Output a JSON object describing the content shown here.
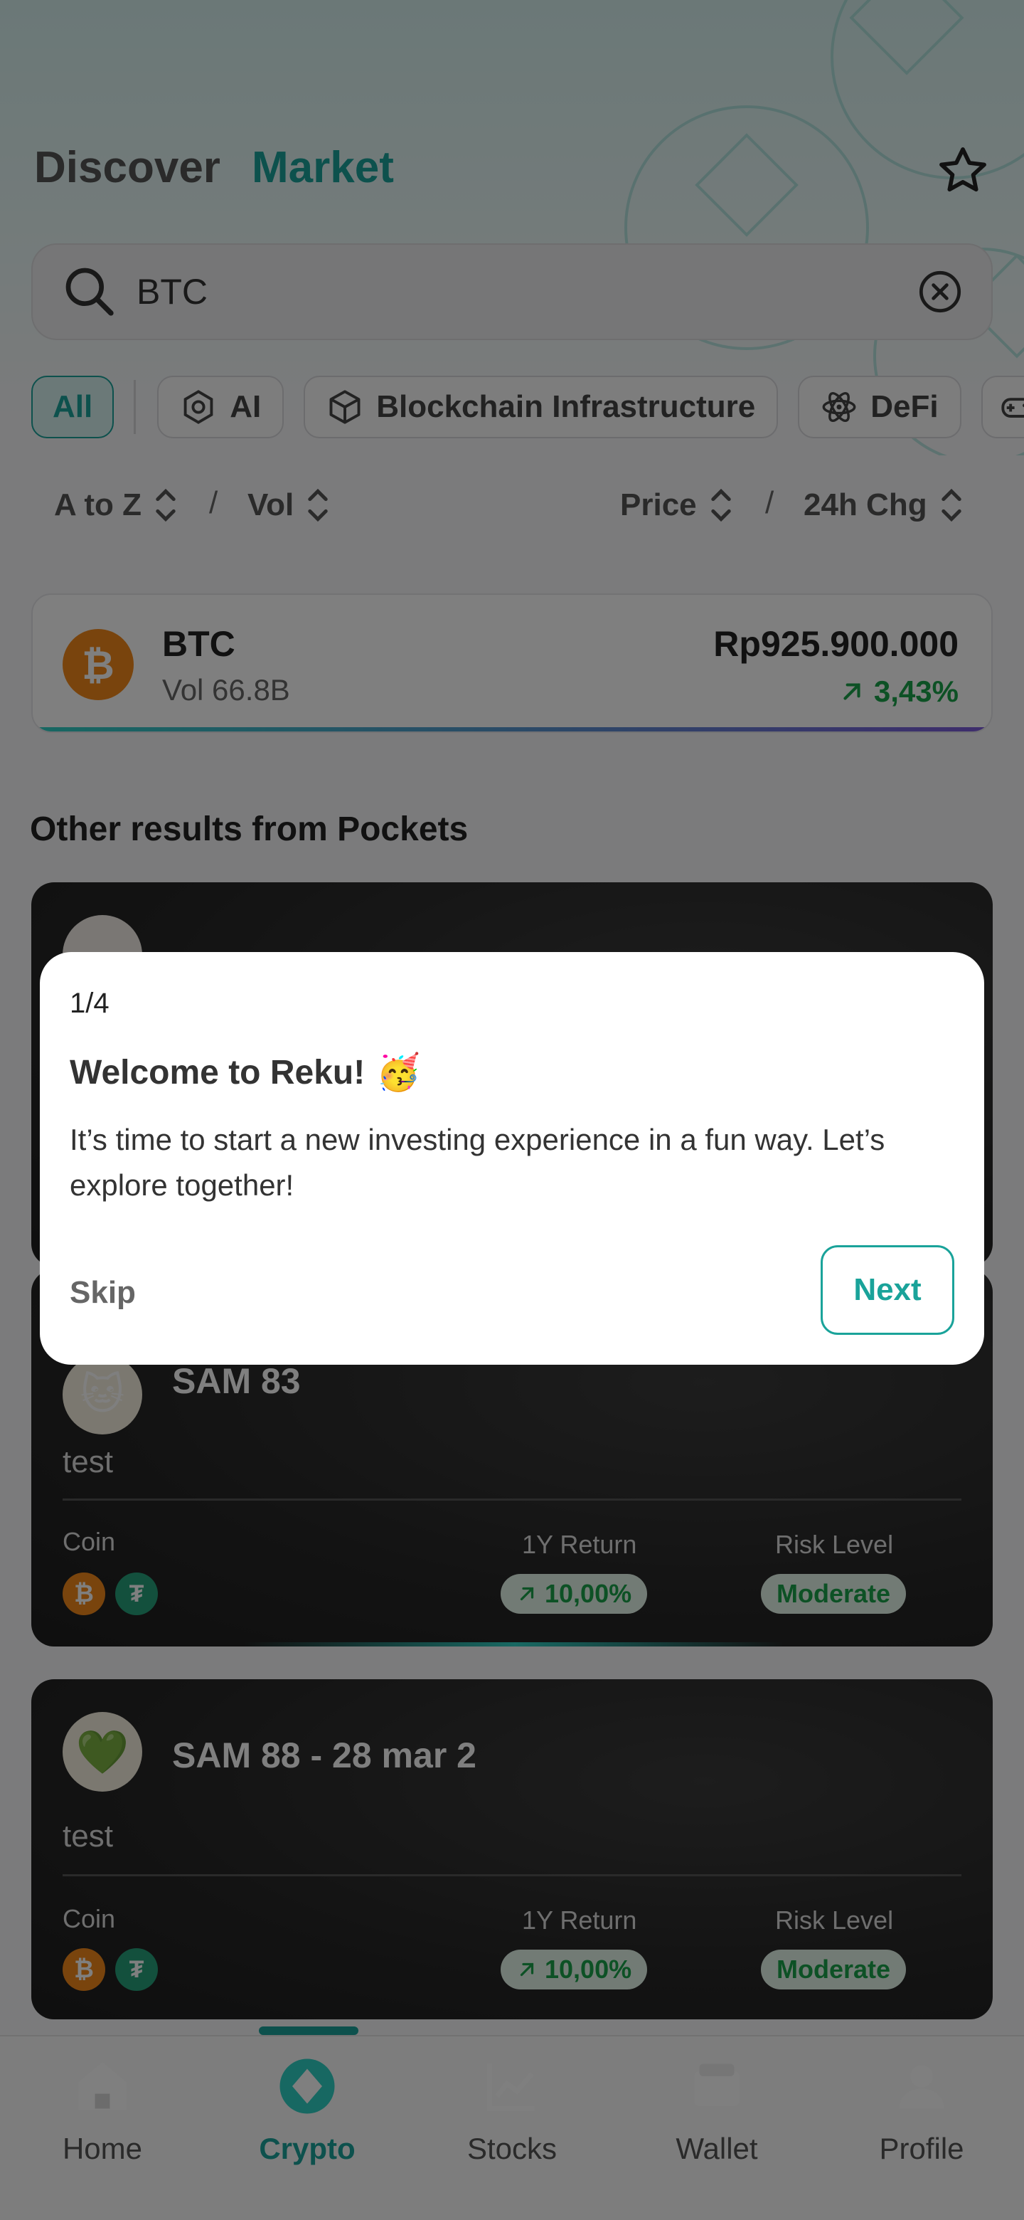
{
  "header": {
    "tab_discover": "Discover",
    "tab_market": "Market",
    "favorite_icon": "star-icon"
  },
  "search": {
    "value": "BTC",
    "search_icon": "search-icon",
    "clear_icon": "clear-icon"
  },
  "filters": {
    "chips": [
      {
        "label": "All",
        "active": true
      },
      {
        "label": "AI",
        "icon": "ai-chip-icon"
      },
      {
        "label": "Blockchain Infrastructure",
        "icon": "cube-icon"
      },
      {
        "label": "DeFi",
        "icon": "atom-icon"
      }
    ]
  },
  "sort": {
    "a_to_z": "A to Z",
    "vol": "Vol",
    "price": "Price",
    "change_24h": "24h Chg",
    "separator": "/"
  },
  "coin_result": {
    "symbol": "BTC",
    "logo_glyph": "₿",
    "volume": "Vol 66.8B",
    "price": "Rp925.900.000",
    "change": "3,43%",
    "change_color": "#1aa34a"
  },
  "section": {
    "other_results": "Other results from Pockets"
  },
  "pockets": [
    {
      "name": "SAM 83",
      "avatar": "🐱",
      "description": "test",
      "coin_label": "Coin",
      "return_label": "1Y Return",
      "return_value": "10,00%",
      "risk_label": "Risk Level",
      "risk_value": "Moderate"
    },
    {
      "name": "SAM 88 - 28 mar 2",
      "avatar": "💚",
      "description": "test",
      "coin_label": "Coin",
      "return_label": "1Y Return",
      "return_value": "10,00%",
      "risk_label": "Risk Level",
      "risk_value": "Moderate"
    }
  ],
  "nav": {
    "items": [
      {
        "label": "Home",
        "icon": "home-icon"
      },
      {
        "label": "Crypto",
        "icon": "crypto-icon",
        "active": true
      },
      {
        "label": "Stocks",
        "icon": "stocks-icon"
      },
      {
        "label": "Wallet",
        "icon": "wallet-icon"
      },
      {
        "label": "Profile",
        "icon": "profile-icon"
      }
    ]
  },
  "modal": {
    "step": "1/4",
    "title": "Welcome to Reku!",
    "title_emoji": "🥳",
    "body": "It’s time to start a new investing experience in a fun way. Let’s explore together!",
    "skip": "Skip",
    "next": "Next"
  },
  "colors": {
    "accent": "#1aa39a",
    "positive": "#1aa34a",
    "btc": "#f2891b",
    "usdt": "#26a17b"
  }
}
